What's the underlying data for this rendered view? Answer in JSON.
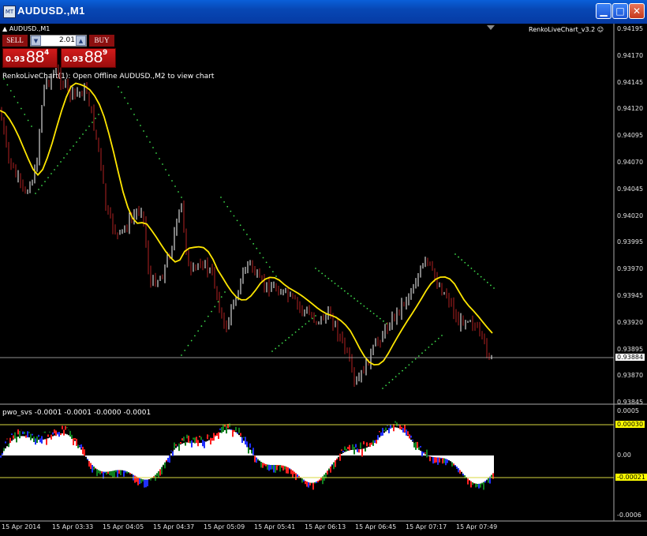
{
  "window": {
    "title": "AUDUSD.,M1",
    "icon": "mt4-chart-icon"
  },
  "controls": {
    "minimize": "minimize-icon",
    "maximize": "maximize-icon",
    "close": "close-icon"
  },
  "chart_header": {
    "symbol": "AUDUSD.,M1",
    "indicator": "RenkoLiveChart_v3.2",
    "message": "RenkoLiveChart(1): Open Offline AUDUSD.,M2 to view chart"
  },
  "trade_panel": {
    "sell_label": "SELL",
    "buy_label": "BUY",
    "lot": "2.01",
    "sell_prefix": "0.93",
    "sell_big": "88",
    "sell_sup": "4",
    "buy_prefix": "0.93",
    "buy_big": "88",
    "buy_sup": "9"
  },
  "price_axis": {
    "labels": [
      "0.94195",
      "0.94170",
      "0.94145",
      "0.94120",
      "0.94095",
      "0.94070",
      "0.94045",
      "0.94020",
      "0.93995",
      "0.93970",
      "0.93945",
      "0.93920",
      "0.93895",
      "0.93870",
      "0.93845"
    ],
    "current": "0.93884"
  },
  "indicator": {
    "title": "pwo_svs -0.0001 -0.0001 -0.0000 -0.0001",
    "axis": [
      "0.0005",
      "0.00",
      "-0.0006"
    ],
    "upper": "0.00030",
    "lower": "-0.00021"
  },
  "time_axis": [
    "15 Apr 2014",
    "15 Apr 03:33",
    "15 Apr 04:05",
    "15 Apr 04:37",
    "15 Apr 05:09",
    "15 Apr 05:41",
    "15 Apr 06:13",
    "15 Apr 06:45",
    "15 Apr 07:17",
    "15 Apr 07:49"
  ],
  "colors": {
    "bg": "#000000",
    "candle_up": "#ffffff",
    "candle_down": "#b22222",
    "ma": "#ffe600",
    "envelope": "#3ddc4a",
    "current_line": "#c0c0c0",
    "level_line": "#d8d840",
    "hist_red": "#ff2020",
    "hist_blue": "#2030ff",
    "hist_green": "#108020",
    "hist_white": "#ffffff"
  }
}
